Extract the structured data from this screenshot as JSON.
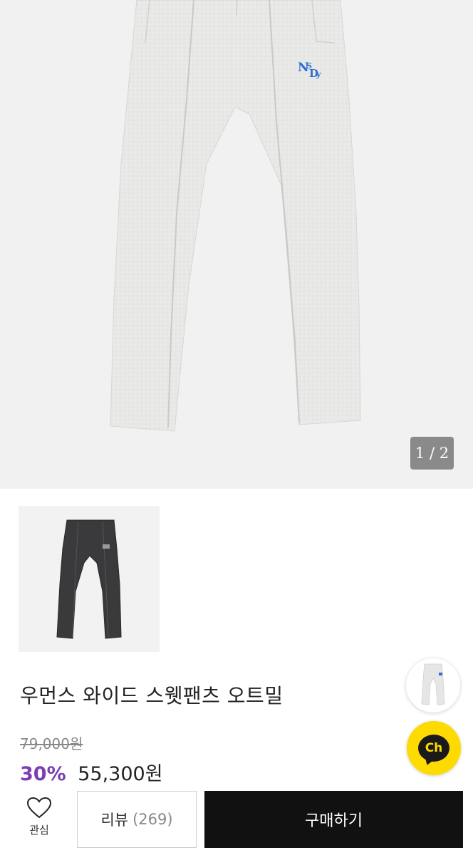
{
  "gallery": {
    "page_indicator": "1 / 2",
    "current_page": 1,
    "total_pages": 2
  },
  "product": {
    "title": "우먼스 와이드 스웻팬츠 오트밀",
    "original_price": "79,000원",
    "discount": "30%",
    "sale_price": "55,300원"
  },
  "actions": {
    "wish_label": "관심",
    "review_label": "리뷰",
    "review_count": "(269)",
    "buy_label": "구매하기"
  },
  "chat": {
    "label": "Ch"
  },
  "icons": {
    "wish": "heart-icon",
    "chat": "chat-icon"
  },
  "colors": {
    "discount": "#7b3fb3",
    "chat_bg": "#fedb00",
    "buy_bg": "#111111",
    "logo_blue": "#2f6fd0"
  }
}
